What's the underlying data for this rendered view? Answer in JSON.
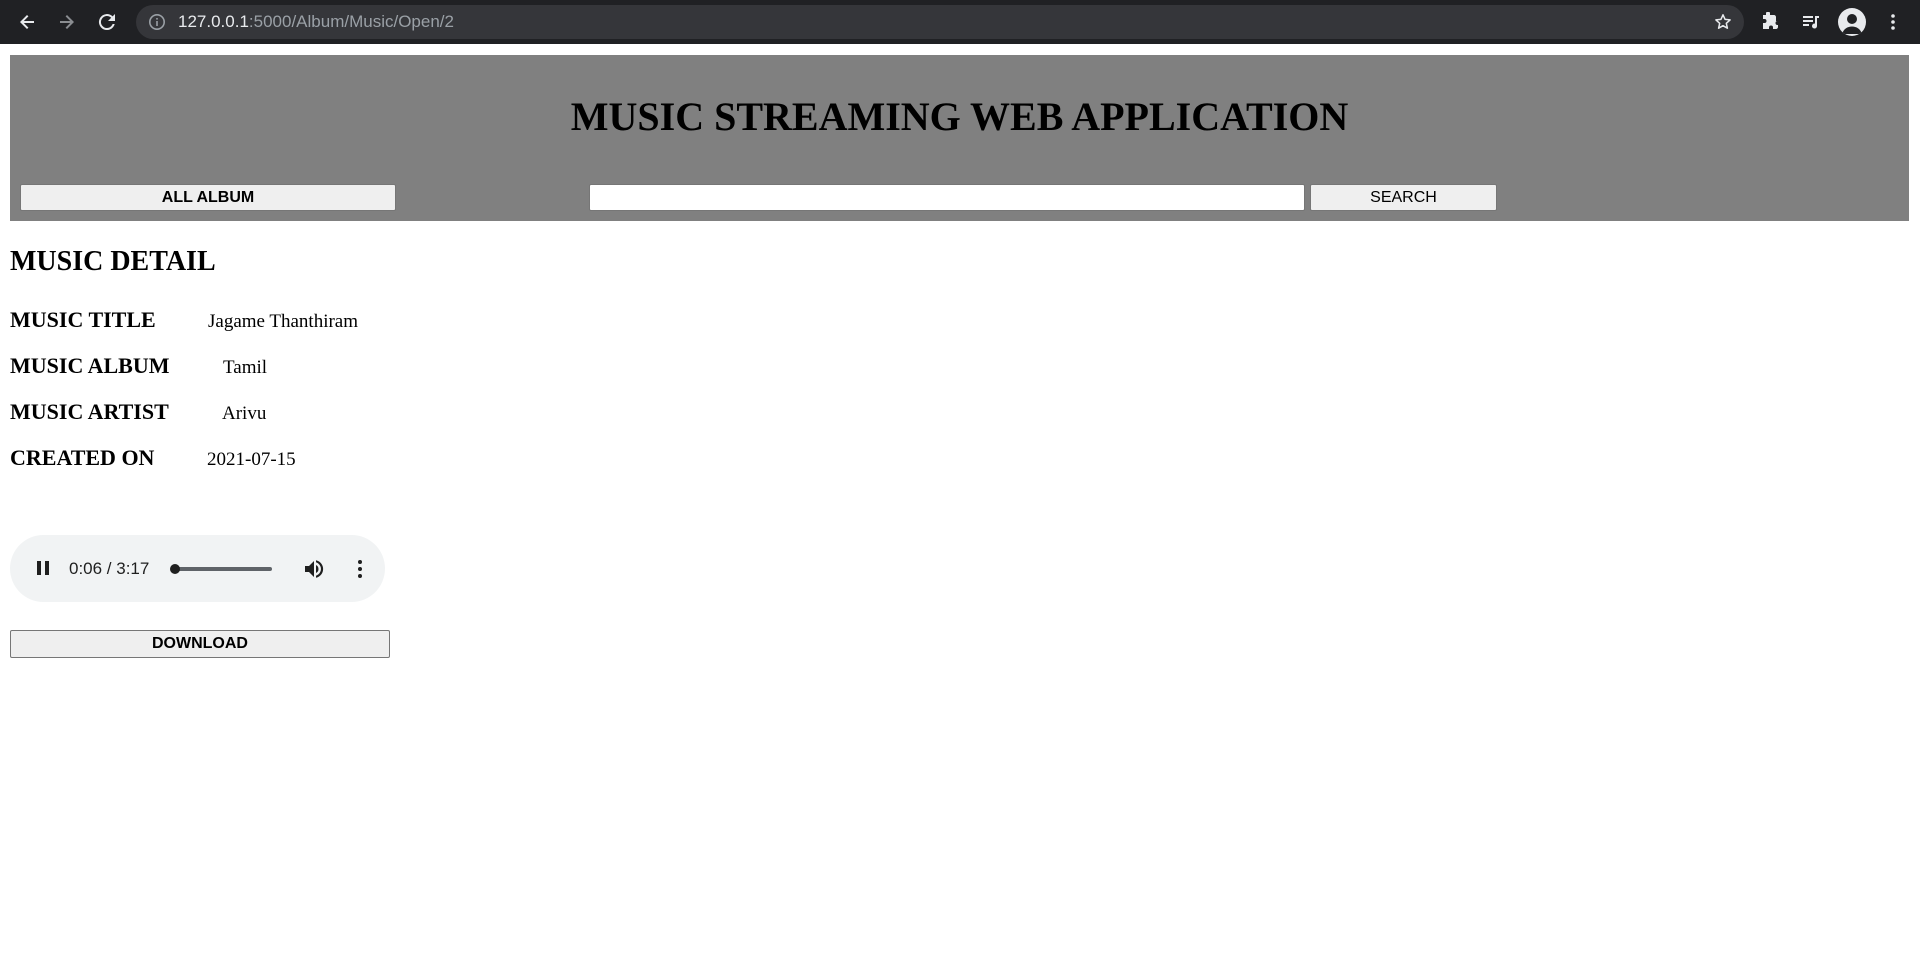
{
  "browser": {
    "url_host": "127.0.0.1",
    "url_path": ":5000/Album/Music/Open/2"
  },
  "header": {
    "title": "MUSIC STREAMING WEB APPLICATION",
    "all_album_label": "ALL ALBUM",
    "search_value": "",
    "search_label": "SEARCH"
  },
  "detail": {
    "section_title": "MUSIC DETAIL",
    "rows": [
      {
        "label": "MUSIC TITLE",
        "value": "Jagame Thanthiram"
      },
      {
        "label": "MUSIC ALBUM",
        "value": "Tamil"
      },
      {
        "label": "MUSIC ARTIST",
        "value": "Arivu"
      },
      {
        "label": "CREATED ON",
        "value": "2021-07-15"
      }
    ]
  },
  "player": {
    "time_display": "0:06 / 3:17",
    "progress_fraction": 0.03,
    "state": "playing"
  },
  "download_label": "DOWNLOAD",
  "icons": {
    "back": "back-arrow-icon",
    "forward": "forward-arrow-icon",
    "reload": "reload-icon",
    "info": "info-icon",
    "star": "star-icon",
    "extensions": "puzzle-icon",
    "media": "media-queue-icon",
    "profile": "profile-icon",
    "menu": "kebab-menu-icon",
    "pause": "pause-icon",
    "volume": "volume-icon",
    "more": "more-options-icon"
  },
  "colors": {
    "chrome_bg": "#202124",
    "omnibox_bg": "#35363a",
    "header_bg": "#808080",
    "button_bg": "#efefef",
    "player_bg": "#f1f3f4"
  }
}
